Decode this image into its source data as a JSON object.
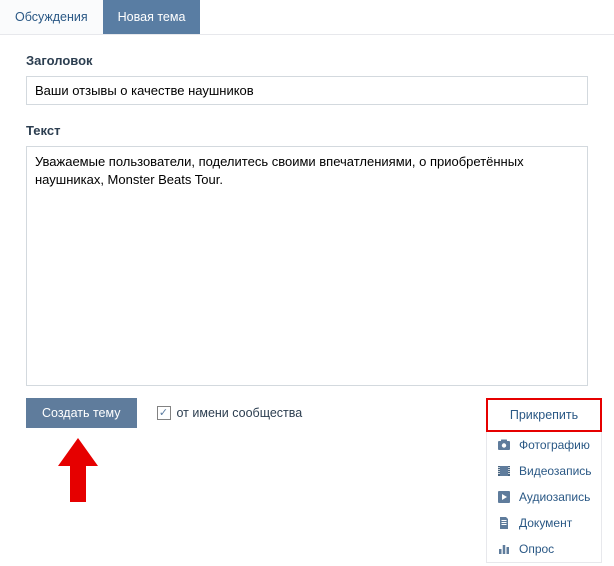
{
  "tabs": {
    "discussions": "Обсуждения",
    "new_topic": "Новая тема"
  },
  "form": {
    "title_label": "Заголовок",
    "title_value": "Ваши отзывы о качестве наушников",
    "text_label": "Текст",
    "text_value": "Уважаемые пользователи, поделитесь своими впечатлениями, о приобретённых наушниках, Monster Beats Tour."
  },
  "actions": {
    "create_label": "Создать тему",
    "community_label": "от имени сообщества",
    "community_checked": true
  },
  "attach": {
    "header": "Прикрепить",
    "items": [
      {
        "icon": "camera-icon",
        "label": "Фотографию"
      },
      {
        "icon": "video-icon",
        "label": "Видеозапись"
      },
      {
        "icon": "audio-icon",
        "label": "Аудиозапись"
      },
      {
        "icon": "document-icon",
        "label": "Документ"
      },
      {
        "icon": "poll-icon",
        "label": "Опрос"
      }
    ]
  }
}
